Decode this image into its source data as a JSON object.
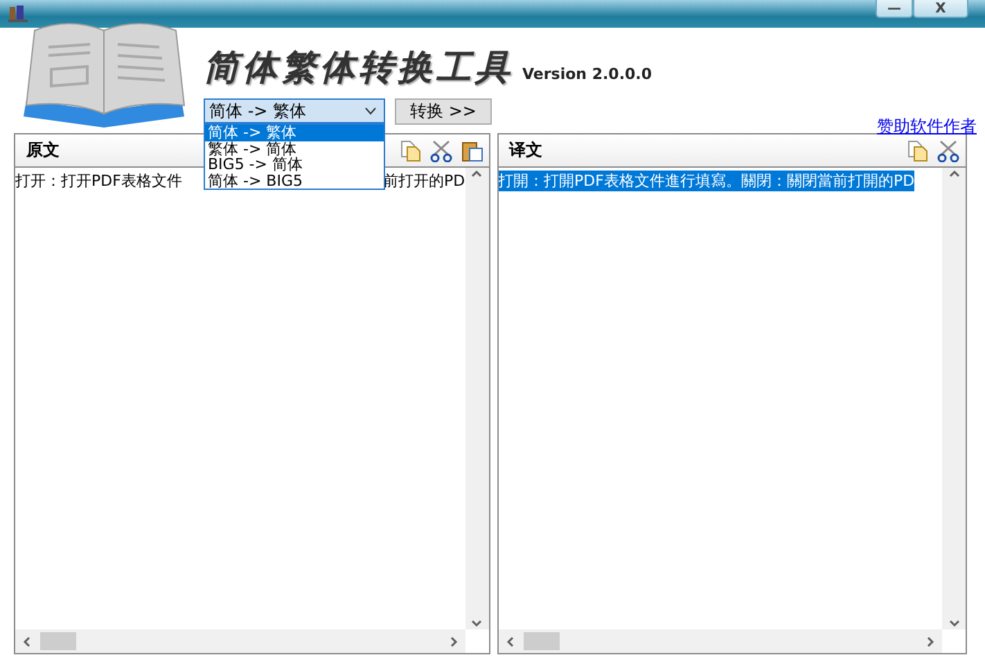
{
  "window": {
    "minimize": "—",
    "close": "X"
  },
  "header": {
    "title": "简体繁体转换工具",
    "version": "Version 2.0.0.0"
  },
  "mode_select": {
    "value": "简体 -> 繁体",
    "expanded": true,
    "options": [
      {
        "label": "简体 -> 繁体",
        "selected": true
      },
      {
        "label": "繁体 -> 简体",
        "selected": false
      },
      {
        "label": "BIG5 -> 简体",
        "selected": false
      },
      {
        "label": "简体 -> BIG5",
        "selected": false
      }
    ]
  },
  "convert_button": "转换 >>",
  "sponsor_link": "赞助软件作者",
  "panels": [
    {
      "title": "原文",
      "tools": [
        {
          "kind": "copy"
        },
        {
          "kind": "cut"
        },
        {
          "kind": "paste"
        }
      ],
      "text_parts": [
        "打开：打开PDF表格文件",
        "前打开的PD"
      ],
      "text_selected": false
    },
    {
      "title": "译文",
      "tools": [
        {
          "kind": "copy"
        },
        {
          "kind": "cut"
        }
      ],
      "text_parts": [
        "打開：打開PDF表格文件進行填寫。關閉：關閉當前打開的PD"
      ],
      "text_selected": true
    }
  ]
}
